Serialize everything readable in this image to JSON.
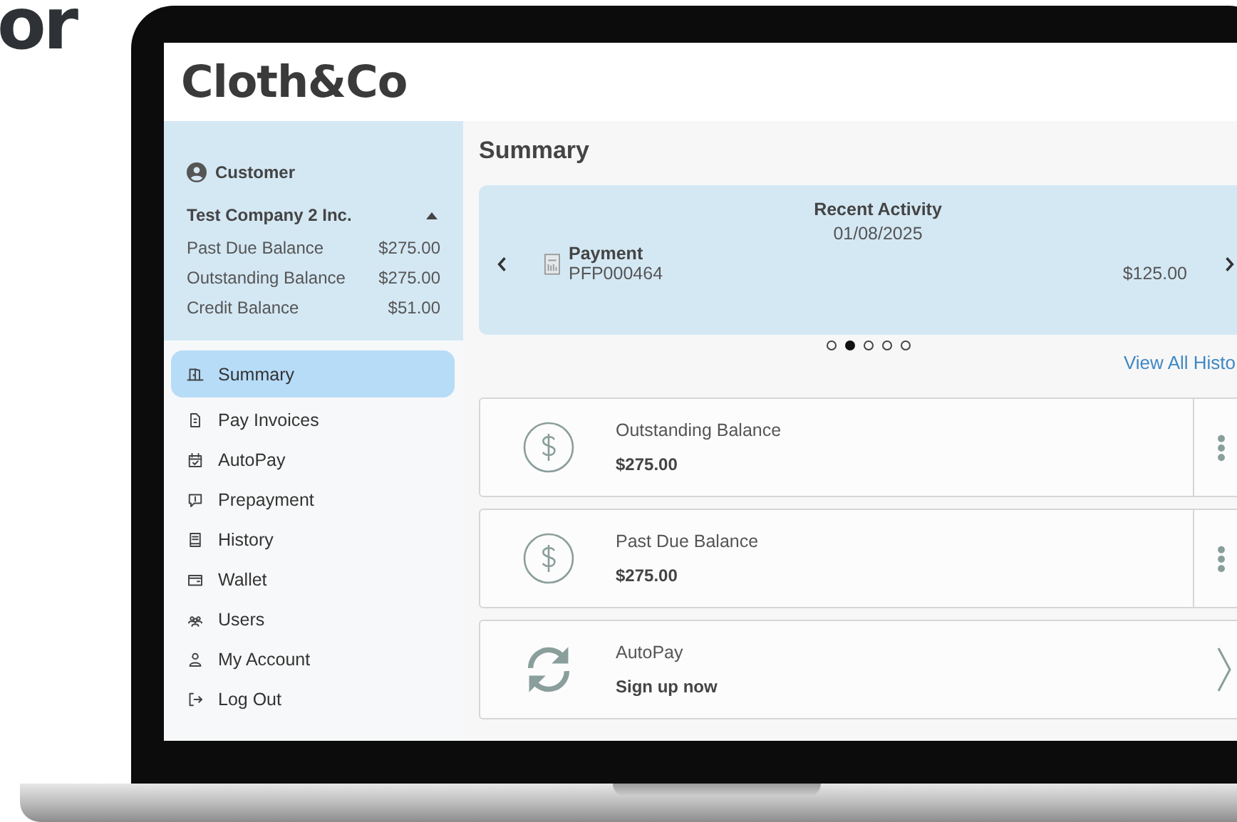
{
  "headline_fragment": "or",
  "logo": "Cloth&Co",
  "customer": {
    "label": "Customer",
    "company": "Test Company 2 Inc.",
    "expanded": true,
    "balances": [
      {
        "label": "Past Due Balance",
        "value": "$275.00"
      },
      {
        "label": "Outstanding Balance",
        "value": "$275.00"
      },
      {
        "label": "Credit Balance",
        "value": "$51.00"
      }
    ]
  },
  "nav": [
    {
      "label": "Summary",
      "selected": true
    },
    {
      "label": "Pay Invoices",
      "selected": false
    },
    {
      "label": "AutoPay",
      "selected": false
    },
    {
      "label": "Prepayment",
      "selected": false
    },
    {
      "label": "History",
      "selected": false
    },
    {
      "label": "Wallet",
      "selected": false
    },
    {
      "label": "Users",
      "selected": false
    },
    {
      "label": "My Account",
      "selected": false
    },
    {
      "label": "Log Out",
      "selected": false
    }
  ],
  "page_title": "Summary",
  "recent_activity": {
    "title": "Recent Activity",
    "date": "01/08/2025",
    "type": "Payment",
    "reference": "PFP000464",
    "amount": "$125.00",
    "dots": [
      {
        "selected": false
      },
      {
        "selected": true
      },
      {
        "selected": false
      },
      {
        "selected": false
      },
      {
        "selected": false
      }
    ]
  },
  "view_all_link": "View All Histo",
  "cards": [
    {
      "kind": "balance",
      "title": "Outstanding Balance",
      "value": "$275.00"
    },
    {
      "kind": "balance",
      "title": "Past Due Balance",
      "value": "$275.00"
    },
    {
      "kind": "action",
      "title": "AutoPay",
      "value": "Sign up now"
    }
  ]
}
